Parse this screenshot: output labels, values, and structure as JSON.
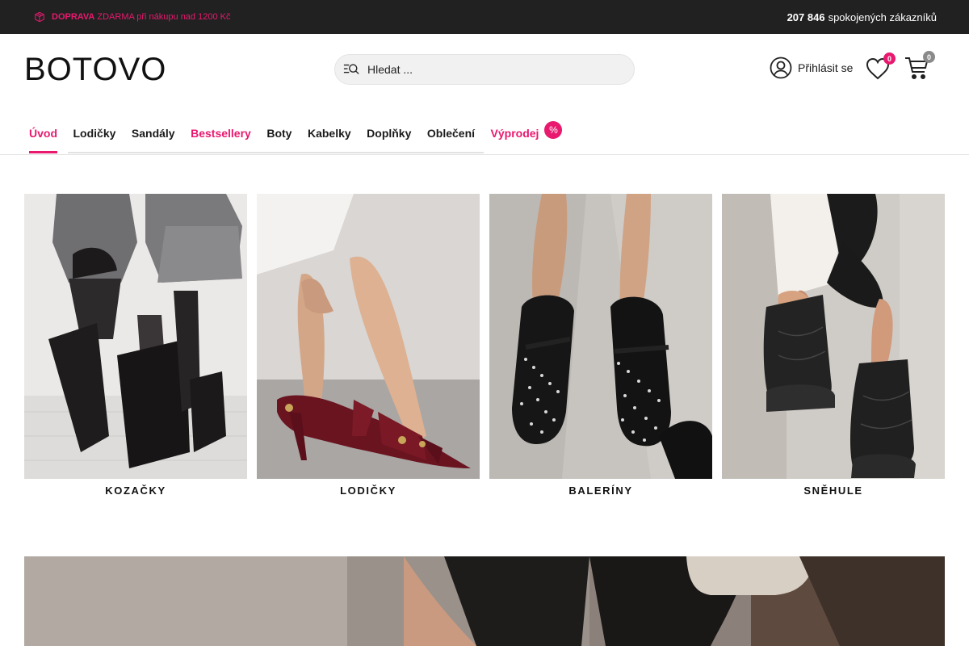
{
  "topbar": {
    "promo_bold": "DOPRAVA",
    "promo_rest": "ZDARMA při nákupu nad 1200 Kč",
    "customers_count": "207 846",
    "customers_text": "spokojených zákazníků"
  },
  "header": {
    "logo": "BOTOVO",
    "search_placeholder": "Hledat ...",
    "login_label": "Přihlásit se",
    "wishlist_count": "0",
    "cart_count": "0"
  },
  "nav": {
    "items": [
      {
        "label": "Úvod"
      },
      {
        "label": "Lodičky"
      },
      {
        "label": "Sandály"
      },
      {
        "label": "Bestsellery"
      },
      {
        "label": "Boty"
      },
      {
        "label": "Kabelky"
      },
      {
        "label": "Doplňky"
      },
      {
        "label": "Oblečení"
      },
      {
        "label": "Výprodej"
      }
    ],
    "sale_badge": "%"
  },
  "categories": [
    {
      "label": "KOZAČKY"
    },
    {
      "label": "LODIČKY"
    },
    {
      "label": "BALERÍNY"
    },
    {
      "label": "SNĚHULE"
    }
  ],
  "colors": {
    "accent": "#e8196e",
    "topbar_bg": "#212121"
  }
}
